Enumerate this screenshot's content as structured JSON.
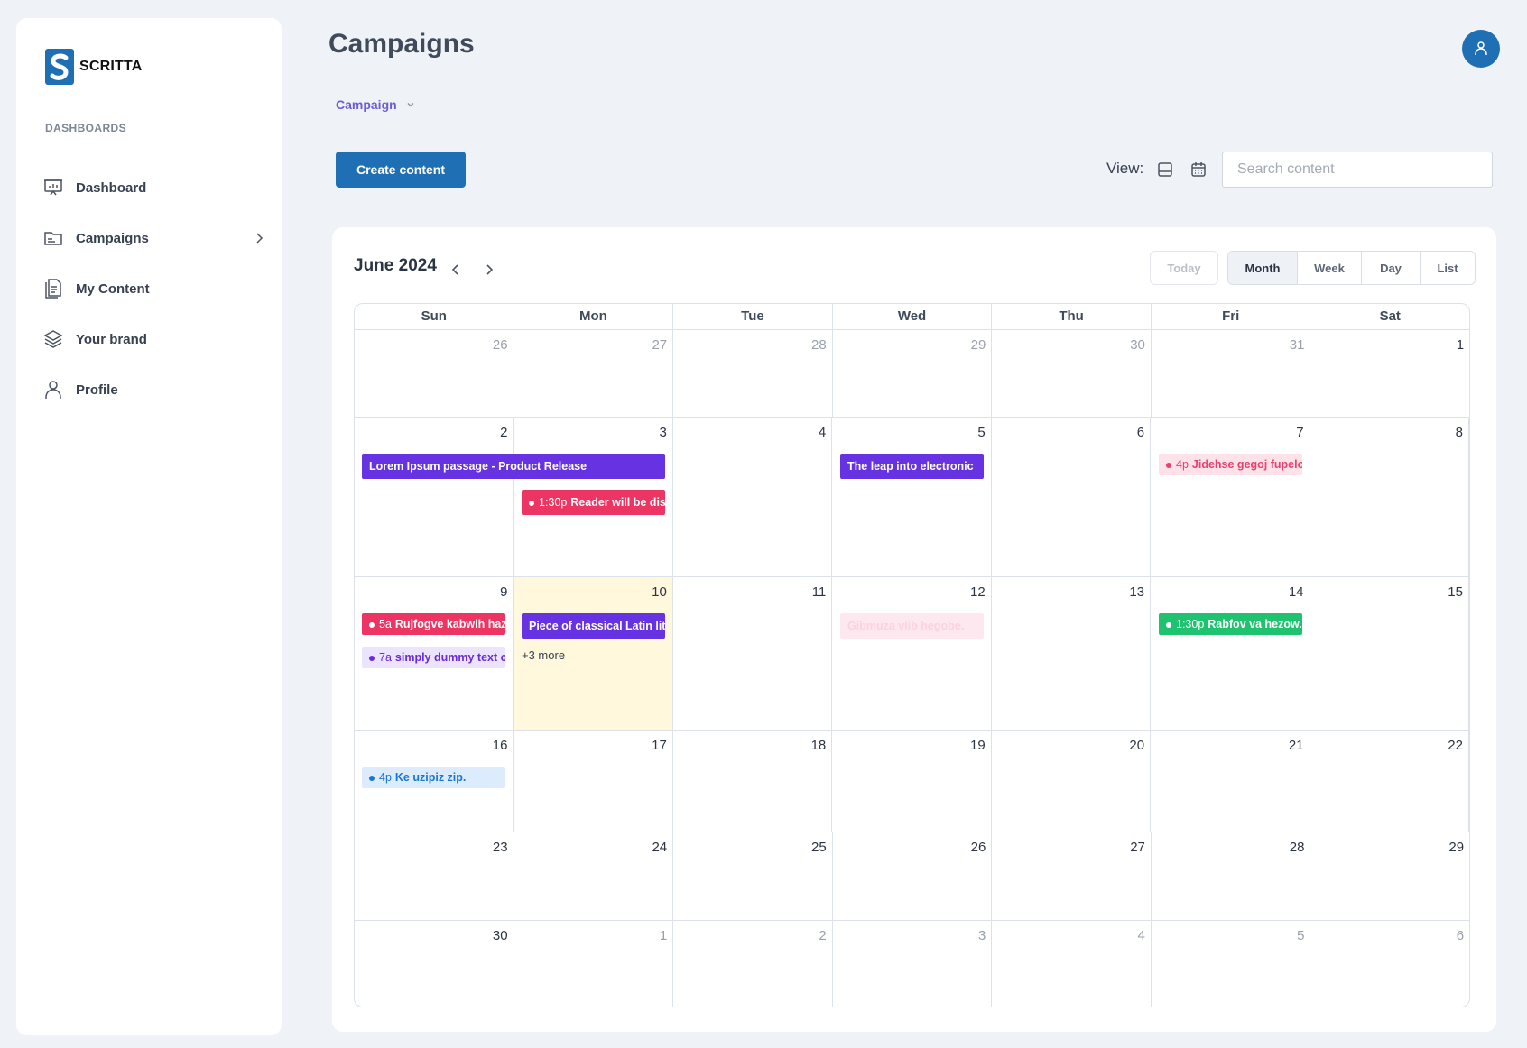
{
  "brand": {
    "name": "SCRITTA",
    "logo_letter": "S"
  },
  "sidebar": {
    "section": "DASHBOARDS",
    "items": [
      {
        "label": "Dashboard",
        "icon": "presentation-chart-icon"
      },
      {
        "label": "Campaigns",
        "icon": "folder-icon"
      },
      {
        "label": "My Content",
        "icon": "documents-icon"
      },
      {
        "label": "Your brand",
        "icon": "layers-icon"
      },
      {
        "label": "Profile",
        "icon": "user-icon"
      }
    ]
  },
  "header": {
    "title": "Campaigns",
    "campaign_select": "Campaign"
  },
  "toolbar": {
    "create_label": "Create content",
    "view_label": "View:",
    "search_placeholder": "Search content"
  },
  "calendar": {
    "title": "June 2024",
    "today_label": "Today",
    "views": [
      "Month",
      "Week",
      "Day",
      "List"
    ],
    "active_view": "Month",
    "weekdays": [
      "Sun",
      "Mon",
      "Tue",
      "Wed",
      "Thu",
      "Fri",
      "Sat"
    ],
    "weeks": [
      [
        "26",
        "27",
        "28",
        "29",
        "30",
        "31",
        "1"
      ],
      [
        "2",
        "3",
        "4",
        "5",
        "6",
        "7",
        "8"
      ],
      [
        "9",
        "10",
        "11",
        "12",
        "13",
        "14",
        "15"
      ],
      [
        "16",
        "17",
        "18",
        "19",
        "20",
        "21",
        "22"
      ],
      [
        "23",
        "24",
        "25",
        "26",
        "27",
        "28",
        "29"
      ],
      [
        "30",
        "1",
        "2",
        "3",
        "4",
        "5",
        "6"
      ]
    ],
    "events": {
      "product_release": {
        "title": "Lorem Ipsum passage - Product Release"
      },
      "reader": {
        "time": "1:30p",
        "title": "Reader will be distracted"
      },
      "leap": {
        "title": "The leap into electronic"
      },
      "jidehse": {
        "time": "4p",
        "title": "Jidehse gegoj fupelo"
      },
      "rujfogve": {
        "time": "5a",
        "title": "Rujfogve kabwih hazo"
      },
      "dummy": {
        "time": "7a",
        "title": "simply dummy text of"
      },
      "classical": {
        "title": "Piece of classical Latin literature"
      },
      "more": "+3 more",
      "gibmuza": {
        "title": "Gibmuza vlib hegobe."
      },
      "rabfov": {
        "time": "1:30p",
        "title": "Rabfov va hezow."
      },
      "ke": {
        "time": "4p",
        "title": "Ke uzipiz zip."
      }
    }
  },
  "colors": {
    "primary": "#1f6fb5",
    "event_purple": "#6733e2",
    "event_red": "#ec3562",
    "event_green": "#1fc36f",
    "today_bg": "#fff8dd"
  }
}
